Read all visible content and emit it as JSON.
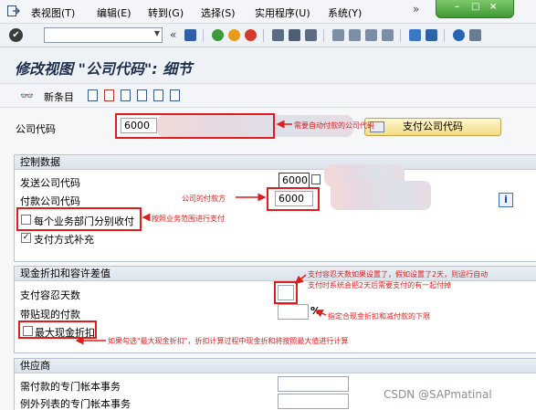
{
  "menubar": {
    "items": [
      "表视图(T)",
      "编辑(E)",
      "转到(G)",
      "选择(S)",
      "实用程序(U)",
      "系统(Y)"
    ],
    "overflow": "»"
  },
  "toolbar": {
    "command_value": "",
    "nav_back": "«"
  },
  "screen": {
    "title": "修改视图 \"公司代码\": 细节"
  },
  "app_toolbar": {
    "new_entries": "新条目"
  },
  "company": {
    "label": "公司代码",
    "value": "6000",
    "pay_button": "支付公司代码"
  },
  "control": {
    "header": "控制数据",
    "sending_label": "发送公司代码",
    "sending_value": "6000",
    "paying_label": "付款公司代码",
    "paying_value": "6000",
    "separate_label": "每个业务部门分别收付",
    "separate_checked": false,
    "method_label": "支付方式补充",
    "method_checked": true,
    "info": "i"
  },
  "discount": {
    "header": "现金折扣和容许差值",
    "tolerance_label": "支付容忍天数",
    "tolerance_value": "",
    "min_discount_label": "带贴现的付款",
    "min_discount_value": "",
    "percent": "%",
    "max_discount_label": "最大现金折扣",
    "max_discount_checked": false
  },
  "vendor": {
    "header": "供应商",
    "special_gl_label": "需付款的专门帐本事务",
    "exceptions_label": "例外列表的专门帐本事务",
    "special_gl_value": "",
    "exceptions_value": ""
  },
  "annotations": {
    "company": "需要自动付款的公司代码",
    "paying": "公司的付款方",
    "separate": "按照业务范围进行支付",
    "tolerance_1": "支付容忍天数如果设置了，假如设置了2天，则运行自动",
    "tolerance_2": "支付时系统会把2天后需要支付的有一起付掉",
    "min_discount": "指定合现金折扣和减付款的下限",
    "max_discount": "如果勾选\"最大现金折扣\"，折扣计算过程中现金折和将按照最大值进行计算"
  },
  "watermark": "CSDN @SAPmatinal",
  "colors": {
    "annotation_red": "#e01c1c",
    "title_navy": "#1d2f4d",
    "sap_green": "#3f9a32"
  }
}
